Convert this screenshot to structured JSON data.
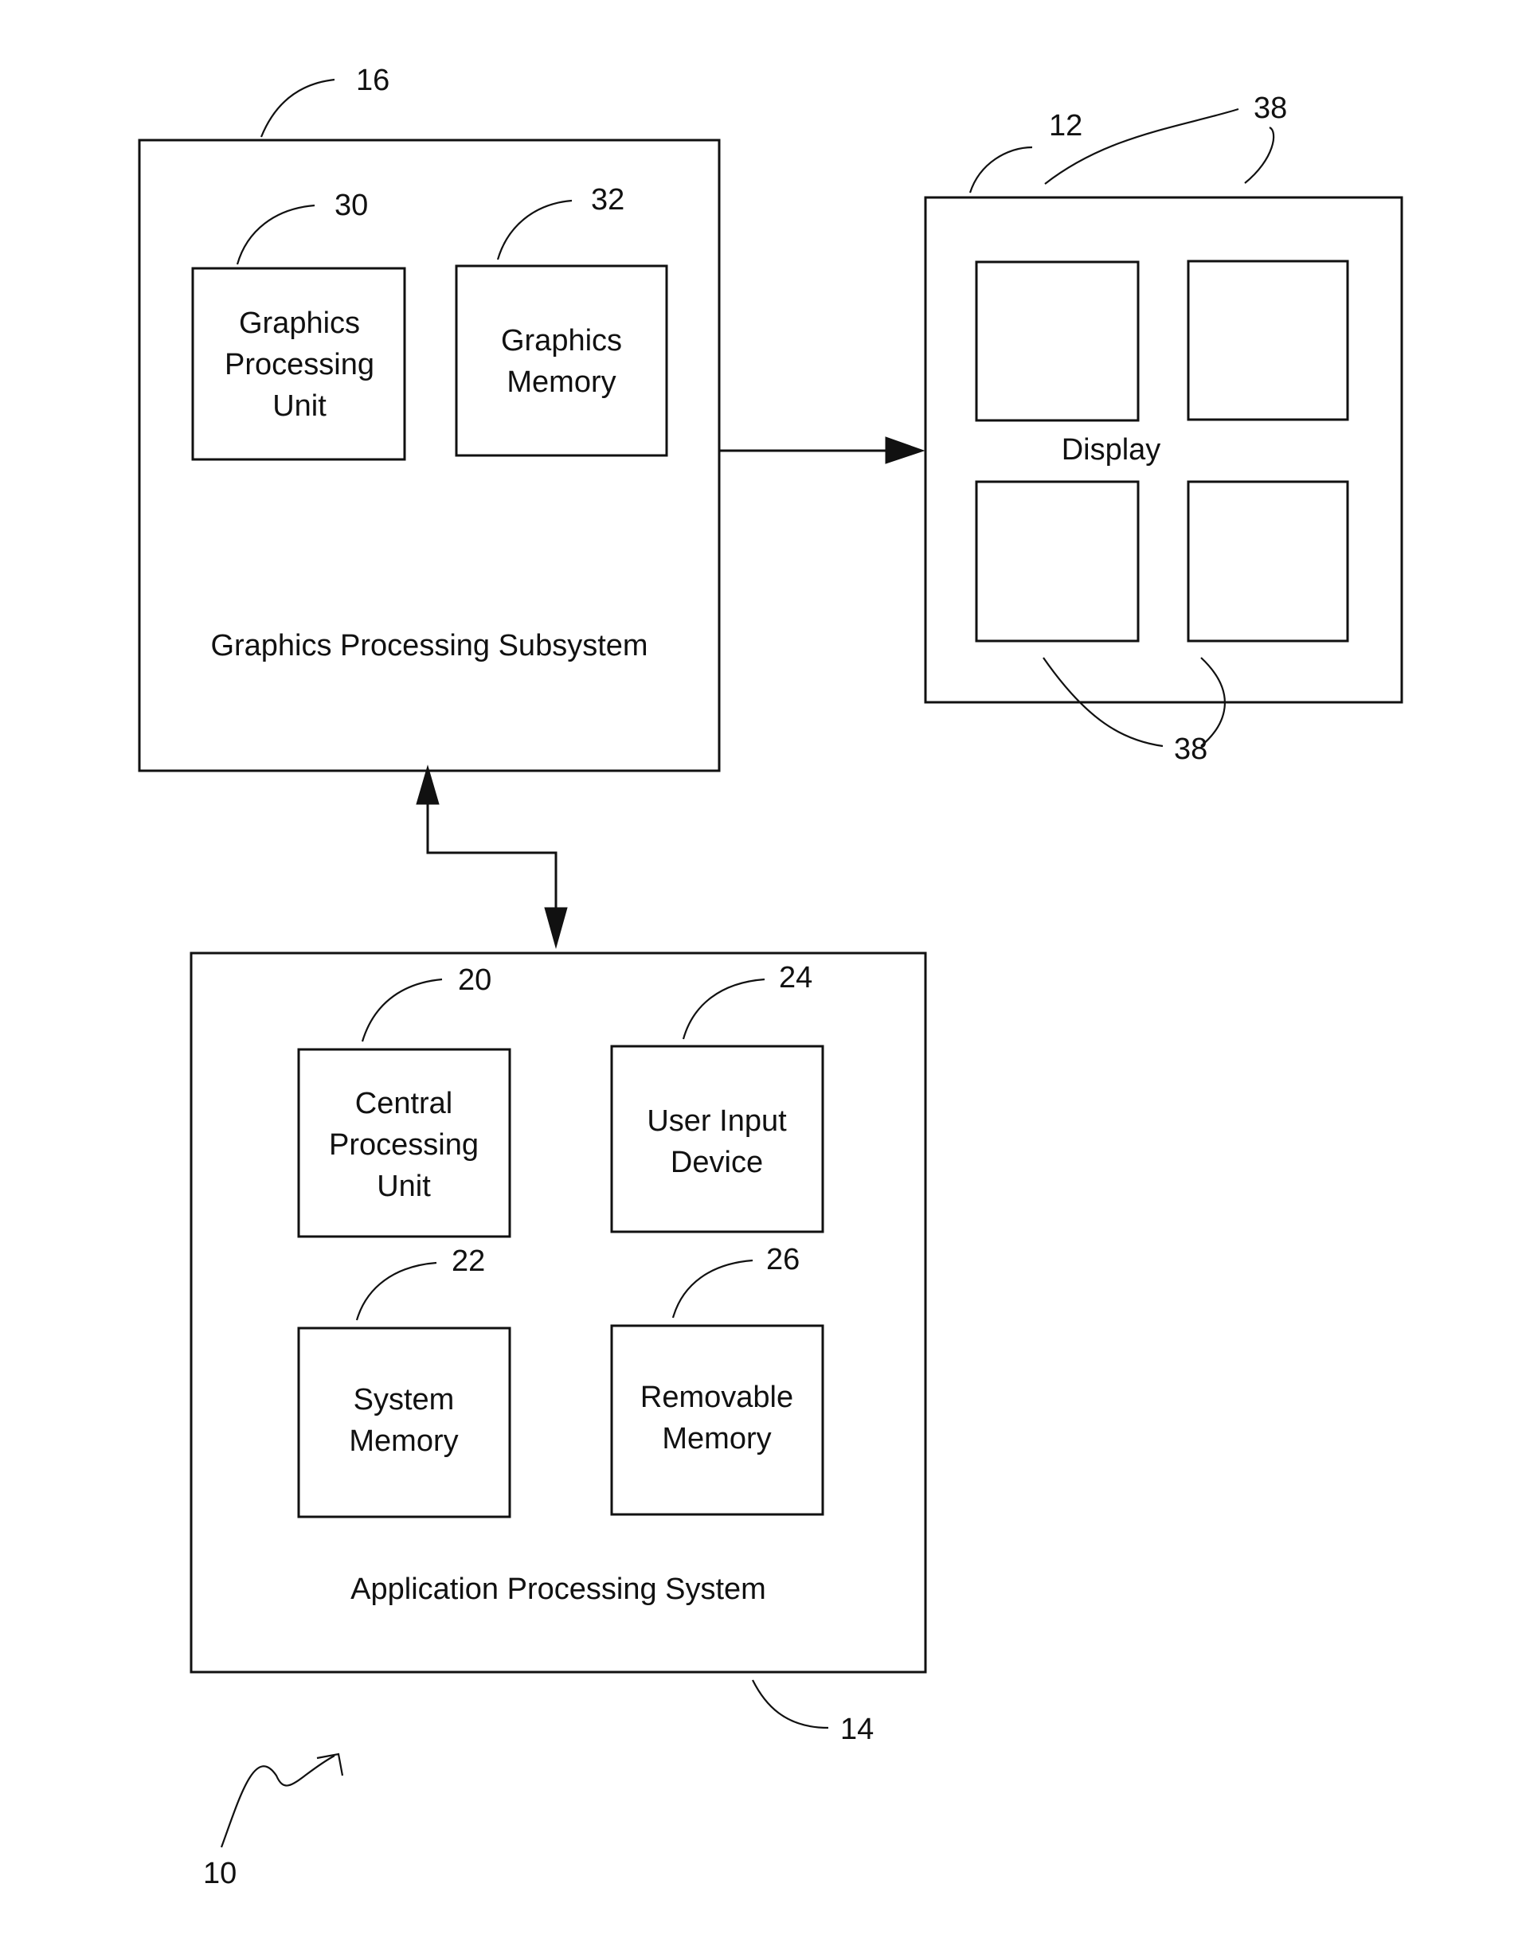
{
  "figure": {
    "system_ref": "10",
    "graphics_subsystem": {
      "ref": "16",
      "label": "Graphics Processing Subsystem",
      "components": [
        {
          "ref": "30",
          "lines": [
            "Graphics",
            "Processing",
            "Unit"
          ]
        },
        {
          "ref": "32",
          "lines": [
            "Graphics",
            "Memory"
          ]
        }
      ]
    },
    "display": {
      "ref": "12",
      "label": "Display",
      "panel_ref_top": "38",
      "panel_ref_bottom": "38",
      "panel_count": 4
    },
    "application_system": {
      "ref": "14",
      "label": "Application Processing System",
      "components": [
        {
          "ref": "20",
          "lines": [
            "Central",
            "Processing",
            "Unit"
          ]
        },
        {
          "ref": "24",
          "lines": [
            "User Input",
            "Device"
          ]
        },
        {
          "ref": "22",
          "lines": [
            "System",
            "Memory"
          ]
        },
        {
          "ref": "26",
          "lines": [
            "Removable",
            "Memory"
          ]
        }
      ]
    },
    "connections": [
      {
        "from": "Graphics Processing Subsystem",
        "to": "Display",
        "direction": "one-way"
      },
      {
        "from": "Graphics Processing Subsystem",
        "to": "Application Processing System",
        "direction": "two-way"
      }
    ]
  }
}
